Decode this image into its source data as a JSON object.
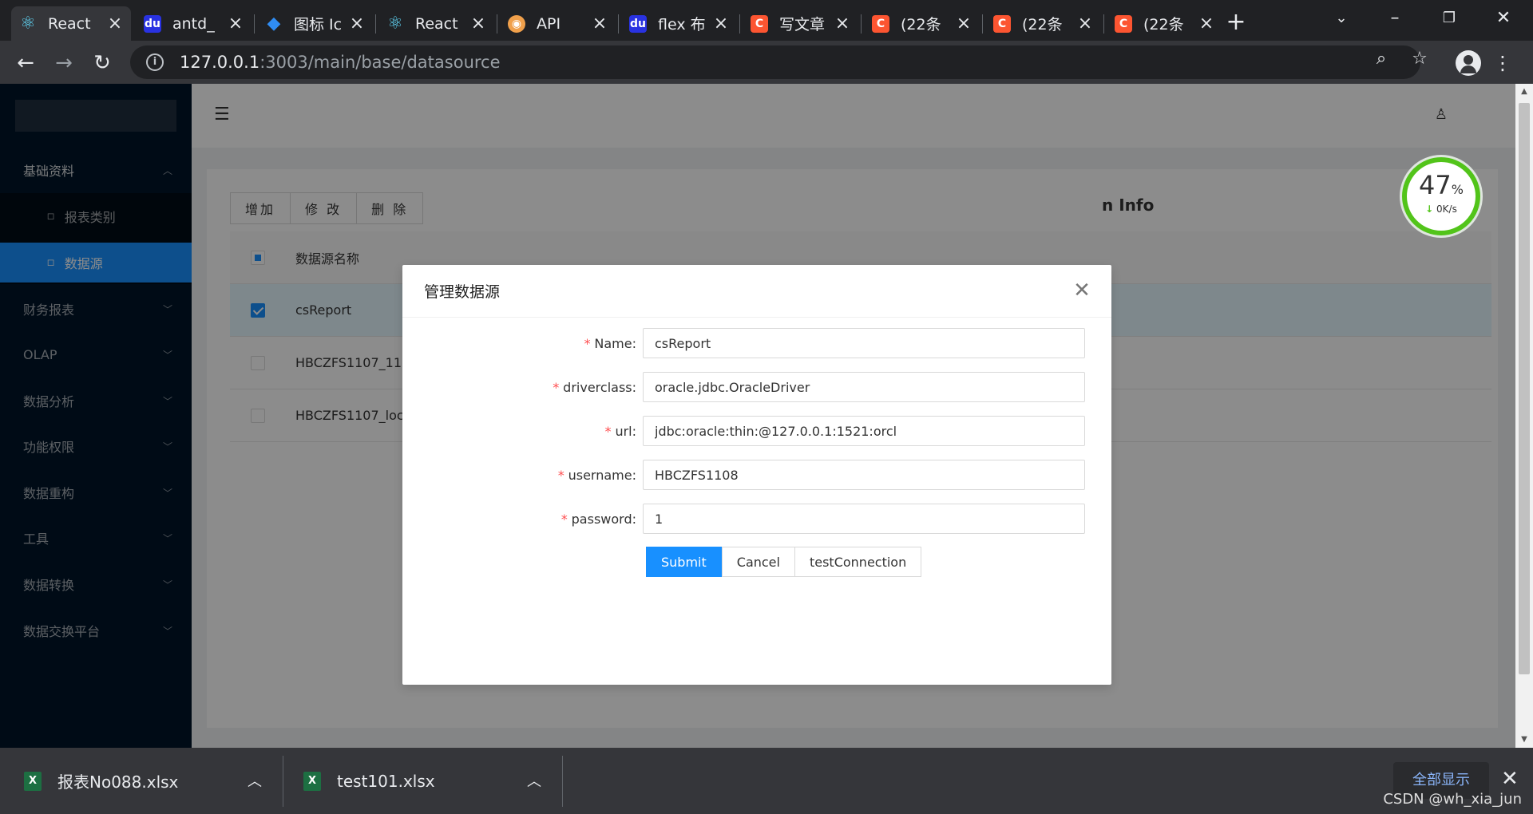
{
  "browser": {
    "tabs": [
      {
        "title": "React",
        "favicon": "react-icon",
        "active": true
      },
      {
        "title": "antd_",
        "favicon": "baidu-icon"
      },
      {
        "title": "图标 Ic",
        "favicon": "iconfont-icon"
      },
      {
        "title": "React",
        "favicon": "react-icon"
      },
      {
        "title": "API",
        "favicon": "api-icon"
      },
      {
        "title": "flex 布",
        "favicon": "baidu-icon"
      },
      {
        "title": "写文章",
        "favicon": "csdn-icon"
      },
      {
        "title": "(22条",
        "favicon": "csdn-icon"
      },
      {
        "title": "(22条",
        "favicon": "csdn-icon"
      },
      {
        "title": "(22条",
        "favicon": "csdn-icon"
      }
    ],
    "url_host": "127.0.0.1",
    "url_path": ":3003/main/base/datasource"
  },
  "sidebar": {
    "items": [
      {
        "label": "基础资料",
        "expanded": true
      },
      {
        "label": "报表类别",
        "sub": true
      },
      {
        "label": "数据源",
        "sub": true,
        "selected": true
      },
      {
        "label": "财务报表"
      },
      {
        "label": "OLAP"
      },
      {
        "label": "数据分析"
      },
      {
        "label": "功能权限"
      },
      {
        "label": "数据重构"
      },
      {
        "label": "工具"
      },
      {
        "label": "数据转换"
      },
      {
        "label": "数据交换平台"
      }
    ]
  },
  "toolbar_buttons": [
    "增加",
    "修 改",
    "删 除"
  ],
  "table": {
    "header": "数据源名称",
    "rows": [
      {
        "name": "csReport",
        "checked": true
      },
      {
        "name": "HBCZFS1107_11",
        "checked": false
      },
      {
        "name": "HBCZFS1107_loc",
        "checked": false
      }
    ]
  },
  "background_text": "n Info",
  "gauge": {
    "percent": "47",
    "unit": "%",
    "speed": "0K/s",
    "ring_fill": 0.47
  },
  "modal": {
    "title": "管理数据源",
    "fields": [
      {
        "label": "Name",
        "value": "csReport"
      },
      {
        "label": "driverclass",
        "value": "oracle.jdbc.OracleDriver"
      },
      {
        "label": "url",
        "value": "jdbc:oracle:thin:@127.0.0.1:1521:orcl"
      },
      {
        "label": "username",
        "value": "HBCZFS1108"
      },
      {
        "label": "password",
        "value": "1"
      }
    ],
    "buttons": {
      "submit": "Submit",
      "cancel": "Cancel",
      "test": "testConnection"
    }
  },
  "downloads": [
    {
      "filename": "报表No088.xlsx"
    },
    {
      "filename": "test101.xlsx"
    }
  ],
  "downloads_show_all": "全部显示",
  "watermark": "CSDN @wh_xia_jun",
  "colors": {
    "primary": "#1890ff",
    "sidebar": "#001529",
    "required": "#ff4d4f",
    "gauge": "#52c41a"
  }
}
